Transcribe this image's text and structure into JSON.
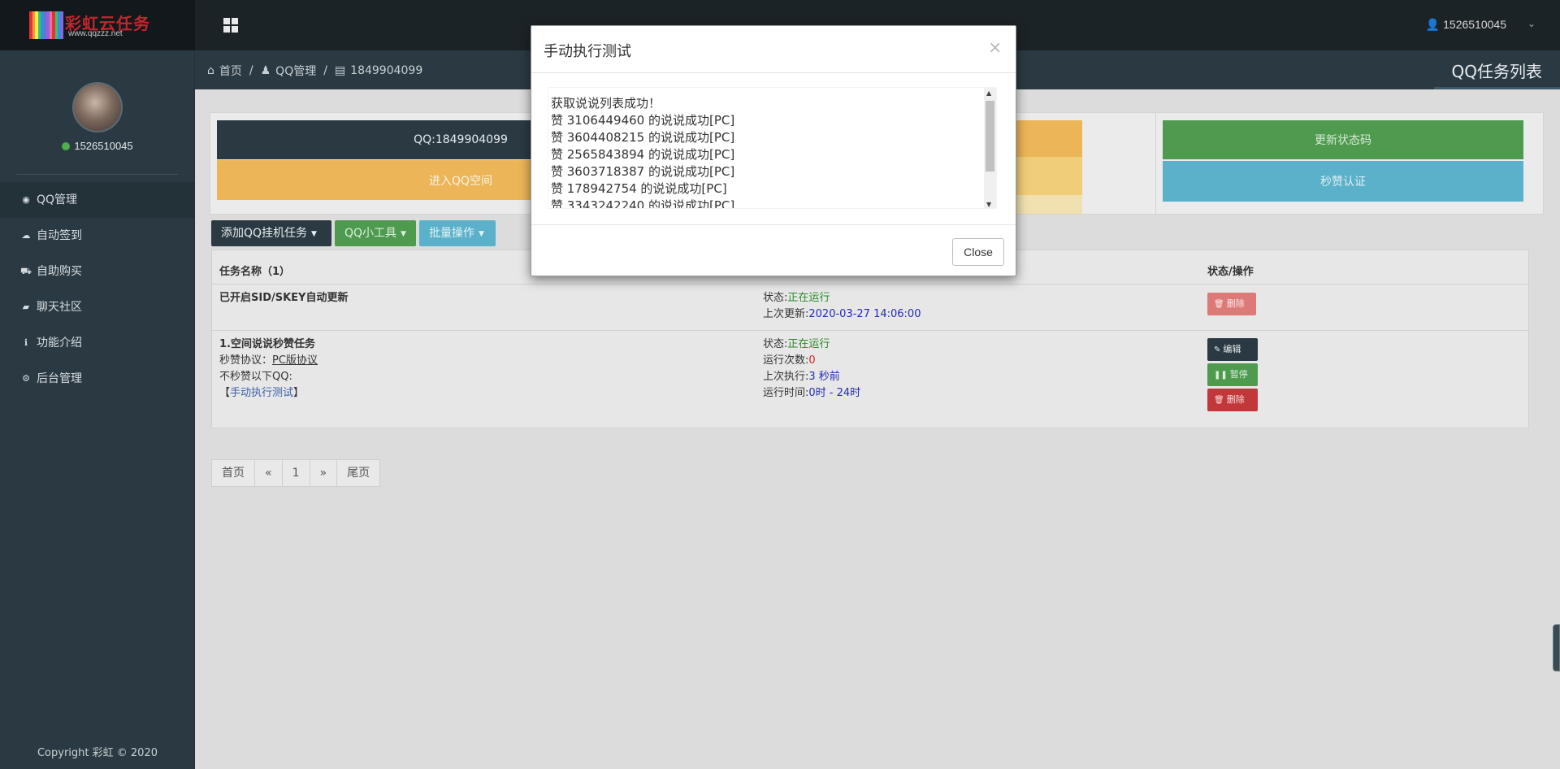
{
  "logo": {
    "brand": "彩虹云任务",
    "site": "www.qqzzz.net",
    "bar_colors": [
      "#e3342f",
      "#f6993f",
      "#ffed4a",
      "#38c172",
      "#3490dc",
      "#6574cd",
      "#9561e2",
      "#f66d9b",
      "#e3342f",
      "#38c172",
      "#3490dc",
      "#9561e2"
    ]
  },
  "topbar": {
    "user": "1526510045",
    "caret": "⌄"
  },
  "sidebar": {
    "user": "1526510045",
    "items": [
      {
        "label": "QQ管理",
        "icon": "globe-icon",
        "glyph": "◉"
      },
      {
        "label": "自动签到",
        "icon": "cloud-icon",
        "glyph": "☁"
      },
      {
        "label": "自助购买",
        "icon": "cart-icon",
        "glyph": "⛟"
      },
      {
        "label": "聊天社区",
        "icon": "comment-icon",
        "glyph": "▰"
      },
      {
        "label": "功能介绍",
        "icon": "info-icon",
        "glyph": "ℹ"
      },
      {
        "label": "后台管理",
        "icon": "gear-icon",
        "glyph": "⚙"
      }
    ],
    "copyright": "Copyright 彩虹 © 2020"
  },
  "breadcrumb": {
    "home": "首页",
    "qq": "QQ管理",
    "account": "1849904099",
    "sep": "/"
  },
  "page_title": "QQ任务列表",
  "tiles": {
    "qq": "QQ:1849904099",
    "space": "进入QQ空间",
    "status_code": "更新状态码",
    "auth": "秒赞认证"
  },
  "buttons": {
    "add_task": "添加QQ挂机任务",
    "tools": "QQ小工具",
    "batch": "批量操作"
  },
  "table": {
    "col_name": "任务名称（1）",
    "col_status": "状态/操作",
    "row1": {
      "title": "已开启SID/SKEY自动更新",
      "status_label": "状态:",
      "status": "正在运行",
      "last_label": "上次更新:",
      "last": "2020-03-27 14:06:00",
      "delete": "删除"
    },
    "row2": {
      "title": "1.空间说说秒赞任务",
      "protocol_label": "秒赞协议：",
      "protocol": "PC版协议",
      "exclude": "不秒赞以下QQ:",
      "manual_open": "【",
      "manual": "手动执行测试",
      "manual_close": "】",
      "status_label": "状态:",
      "status": "正在运行",
      "runs_label": "运行次数:",
      "runs": "0",
      "last_label": "上次执行:",
      "last": "3 秒前",
      "time_label": "运行时间:",
      "time": "0时 - 24时",
      "edit": "编辑",
      "pause": "暂停",
      "delete": "删除"
    }
  },
  "pager": {
    "first": "首页",
    "prev": "«",
    "page": "1",
    "next": "»",
    "last": "尾页"
  },
  "modal": {
    "title": "手动执行测试",
    "close_x": "×",
    "lines": [
      "获取说说列表成功！",
      "赞 3106449460 的说说成功[PC]",
      "赞 3604408215 的说说成功[PC]",
      "赞 2565843894 的说说成功[PC]",
      "赞 3603718387 的说说成功[PC]",
      "赞 178942754 的说说成功[PC]",
      "赞 3343242240 的说说成功[PC]"
    ],
    "close_button": "Close"
  }
}
